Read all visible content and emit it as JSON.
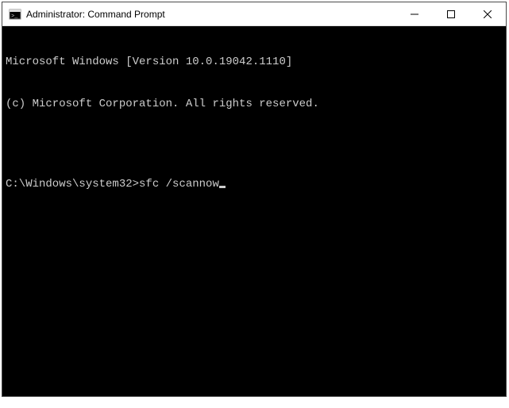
{
  "window": {
    "title": "Administrator: Command Prompt"
  },
  "terminal": {
    "line1": "Microsoft Windows [Version 10.0.19042.1110]",
    "line2": "(c) Microsoft Corporation. All rights reserved.",
    "prompt": "C:\\Windows\\system32>",
    "command": "sfc /scannow"
  }
}
